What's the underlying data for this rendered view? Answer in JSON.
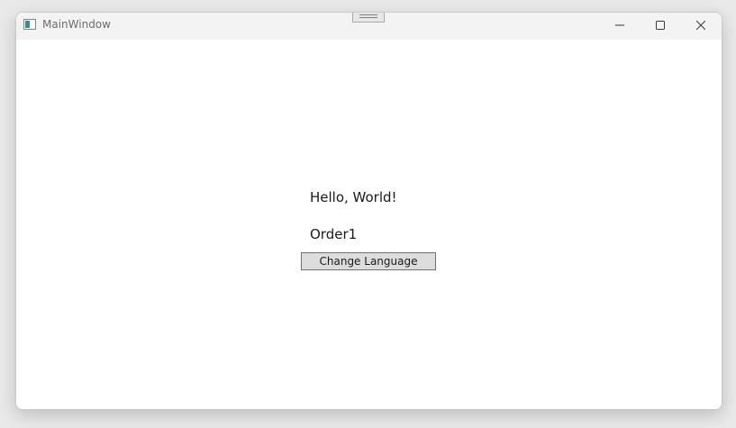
{
  "window": {
    "title": "MainWindow",
    "icon": "app-window-icon"
  },
  "titlebar": {
    "grip_icon": "drag-handle-icon",
    "minimize_icon": "minimize-icon",
    "maximize_icon": "maximize-icon",
    "close_icon": "close-icon"
  },
  "content": {
    "greeting": "Hello, World!",
    "order": "Order1",
    "change_language_label": "Change Language"
  },
  "colors": {
    "titlebar_bg": "#f3f3f3",
    "content_bg": "#ffffff",
    "button_bg": "#dddddd",
    "button_border": "#707070"
  }
}
